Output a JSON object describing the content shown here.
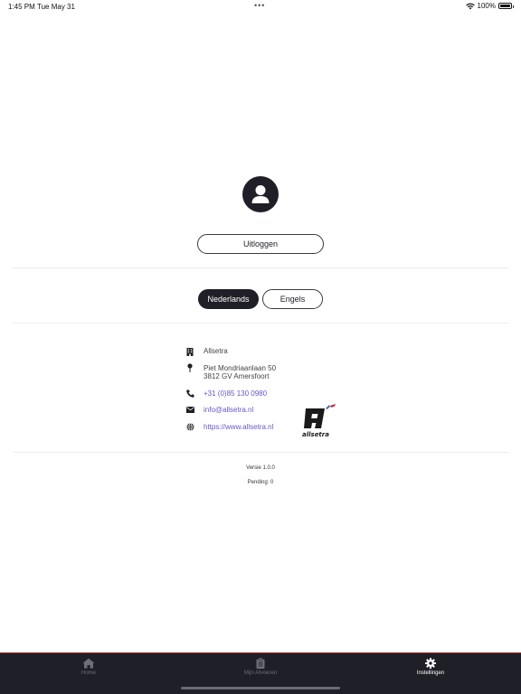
{
  "status_bar": {
    "time": "1:45 PM",
    "date": "Tue May 31",
    "battery": "100%"
  },
  "profile": {
    "avatar_icon": "person-icon",
    "logout_label": "Uitloggen"
  },
  "language": {
    "options": [
      {
        "label": "Nederlands",
        "selected": true
      },
      {
        "label": "Engels",
        "selected": false
      }
    ]
  },
  "contact": {
    "company": "Allsetra",
    "address_line1": "Piet Mondriaanlaan 50",
    "address_line2": "3812 GV Amersfoort",
    "phone": "+31 (0)85 130 0980",
    "email": "info@allsetra.nl",
    "website": "https://www.allsetra.nl",
    "logo_text": "allsetra"
  },
  "meta": {
    "version": "Versie 1.0.0",
    "pending": "Pending: 0"
  },
  "tab_bar": {
    "tabs": [
      {
        "label": "Home",
        "icon": "home-icon",
        "active": false
      },
      {
        "label": "Mijn Afvoeren",
        "icon": "clipboard-icon",
        "active": false
      },
      {
        "label": "Instellingen",
        "icon": "gear-icon",
        "active": true
      }
    ]
  },
  "colors": {
    "dark": "#1f1f27",
    "link": "#6558c7",
    "tab_accent": "#b3262b"
  }
}
